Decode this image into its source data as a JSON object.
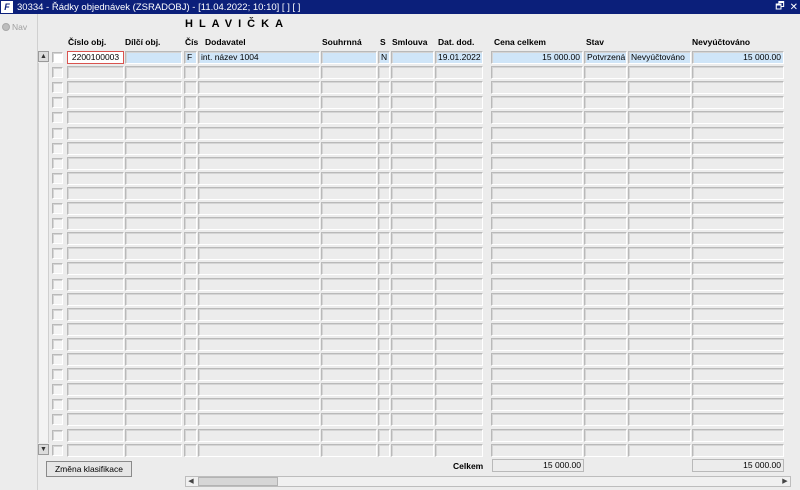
{
  "window": {
    "title": "30334 - Řádky objednávek (ZSRADOBJ) - [11.04.2022; 10:10] [ ] [ ]",
    "restore_glyph": "🗗",
    "close_glyph": "✕",
    "app_icon_glyph": "F"
  },
  "sidebar": {
    "nav_label": "Nav"
  },
  "section_title": "HLAVIČKA",
  "columns": {
    "cislo_obj": "Číslo obj.",
    "dilci_obj": "Dílčí obj.",
    "cis": "Čís",
    "dodavatel": "Dodavatel",
    "souhrnna": "Souhrnná",
    "s": "S",
    "smlouva": "Smlouva",
    "dat_dod": "Dat. dod.",
    "cena_celkem": "Cena celkem",
    "stav": "Stav",
    "nevyuctovano": "Nevyúčtováno"
  },
  "rows": [
    {
      "cislo_obj": "2200100003",
      "dilci_obj": "",
      "cis": "F",
      "dodavatel": "int. název 1004",
      "souhrnna": "",
      "s": "N",
      "smlouva": "",
      "dat_dod": "19.01.2022",
      "cena_celkem": "15 000.00",
      "stav": "Potvrzená",
      "stav2": "Nevyúčtováno",
      "nevyuctovano": "15 000.00"
    }
  ],
  "empty_row_count": 26,
  "footer": {
    "button_label": "Změna klasifikace",
    "celkem_label": "Celkem",
    "total_cena": "15 000.00",
    "total_nevyuctovano": "15 000.00"
  },
  "scroll": {
    "up": "▲",
    "down": "▼",
    "left": "◀",
    "right": "▶"
  },
  "colors": {
    "titlebar": "#0b1f7a",
    "selected_row": "#cfe5f8",
    "focus_border": "#d9534f"
  }
}
